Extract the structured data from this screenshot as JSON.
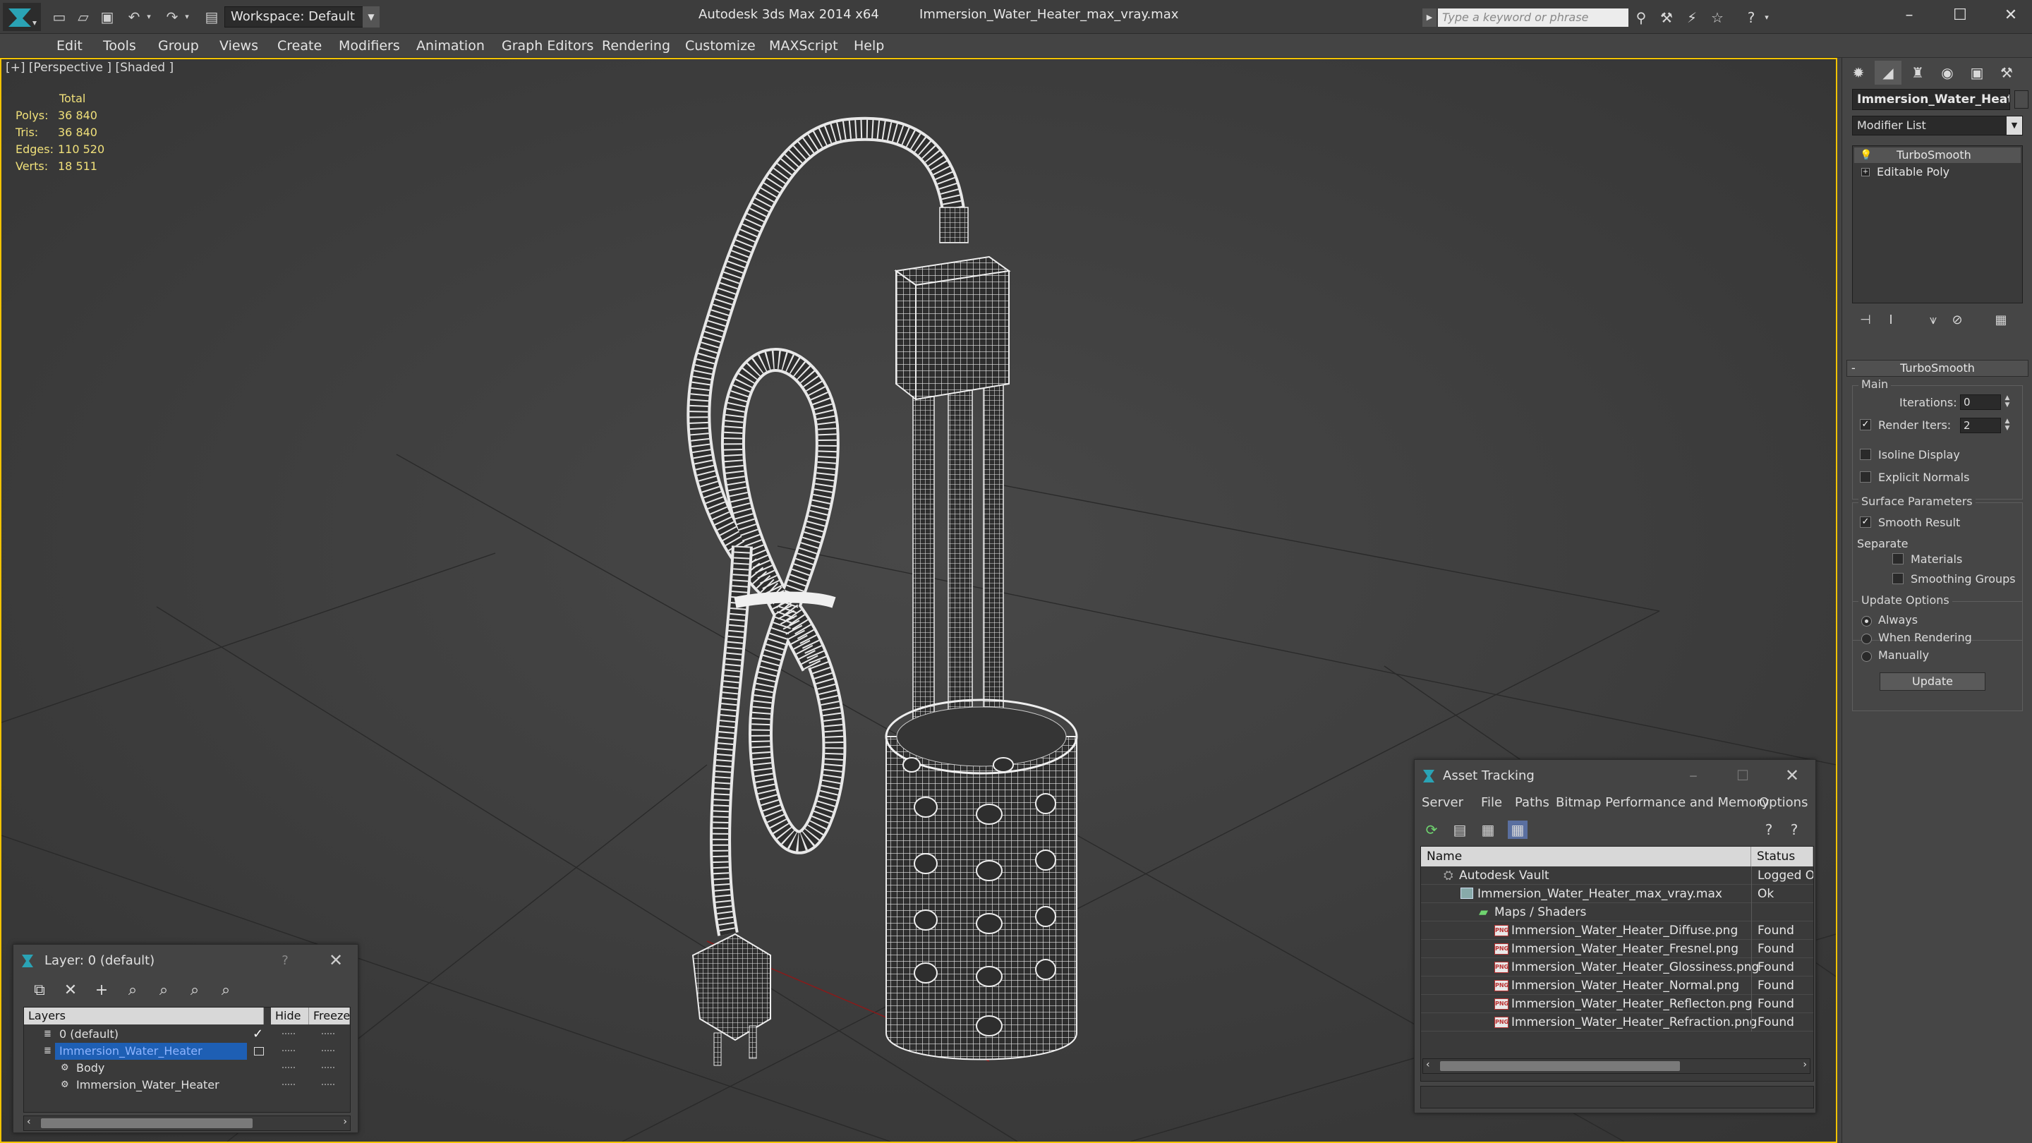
{
  "titlebar": {
    "workspace": "Workspace: Default",
    "app_name": "Autodesk 3ds Max 2014 x64",
    "file_name": "Immersion_Water_Heater_max_vray.max",
    "search_placeholder": "Type a keyword or phrase"
  },
  "menu": [
    "Edit",
    "Tools",
    "Group",
    "Views",
    "Create",
    "Modifiers",
    "Animation",
    "Graph Editors",
    "Rendering",
    "Customize",
    "MAXScript",
    "Help"
  ],
  "viewport": {
    "label": "[+] [Perspective ] [Shaded ]",
    "stats_header": "Total",
    "stats": [
      {
        "key": "Polys:",
        "value": "36 840"
      },
      {
        "key": "Tris:",
        "value": "36 840"
      },
      {
        "key": "Edges:",
        "value": "110 520"
      },
      {
        "key": "Verts:",
        "value": "18 511"
      }
    ]
  },
  "command_panel": {
    "object_name": "Immersion_Water_Heater",
    "modifier_list": "Modifier List",
    "stack": [
      "TurboSmooth",
      "Editable Poly"
    ],
    "rollout_title": "TurboSmooth",
    "main_group": "Main",
    "iterations_label": "Iterations:",
    "iterations_value": "0",
    "render_iters_label": "Render Iters:",
    "render_iters_value": "2",
    "isoline_display": "Isoline Display",
    "explicit_normals": "Explicit Normals",
    "surface_group": "Surface Parameters",
    "smooth_result": "Smooth Result",
    "separate_label": "Separate",
    "materials": "Materials",
    "smoothing_groups": "Smoothing Groups",
    "update_group": "Update Options",
    "always": "Always",
    "when_rendering": "When Rendering",
    "manually": "Manually",
    "update_button": "Update"
  },
  "layer_window": {
    "title": "Layer: 0 (default)",
    "help": "?",
    "columns": [
      "Layers",
      "Hide",
      "Freeze"
    ],
    "rows": [
      {
        "name": "0 (default)"
      },
      {
        "name": "Immersion_Water_Heater"
      },
      {
        "name": "Body"
      },
      {
        "name": "Immersion_Water_Heater"
      }
    ]
  },
  "asset_window": {
    "title": "Asset Tracking",
    "menu": [
      "Server",
      "File",
      "Paths",
      "Bitmap Performance and Memory",
      "Options"
    ],
    "columns": [
      "Name",
      "Status"
    ],
    "rows": [
      {
        "name": "Autodesk Vault",
        "status": "Logged Ou"
      },
      {
        "name": "Immersion_Water_Heater_max_vray.max",
        "status": "Ok"
      },
      {
        "name": "Maps / Shaders",
        "status": ""
      },
      {
        "name": "Immersion_Water_Heater_Diffuse.png",
        "status": "Found"
      },
      {
        "name": "Immersion_Water_Heater_Fresnel.png",
        "status": "Found"
      },
      {
        "name": "Immersion_Water_Heater_Glossiness.png",
        "status": "Found"
      },
      {
        "name": "Immersion_Water_Heater_Normal.png",
        "status": "Found"
      },
      {
        "name": "Immersion_Water_Heater_Reflecton.png",
        "status": "Found"
      },
      {
        "name": "Immersion_Water_Heater_Refraction.png",
        "status": "Found"
      }
    ],
    "png_tag": "PNG"
  },
  "colors": {
    "viewport_border": "#f2c300",
    "stats_text": "#f0e07a",
    "selection": "#1e5fb4"
  }
}
